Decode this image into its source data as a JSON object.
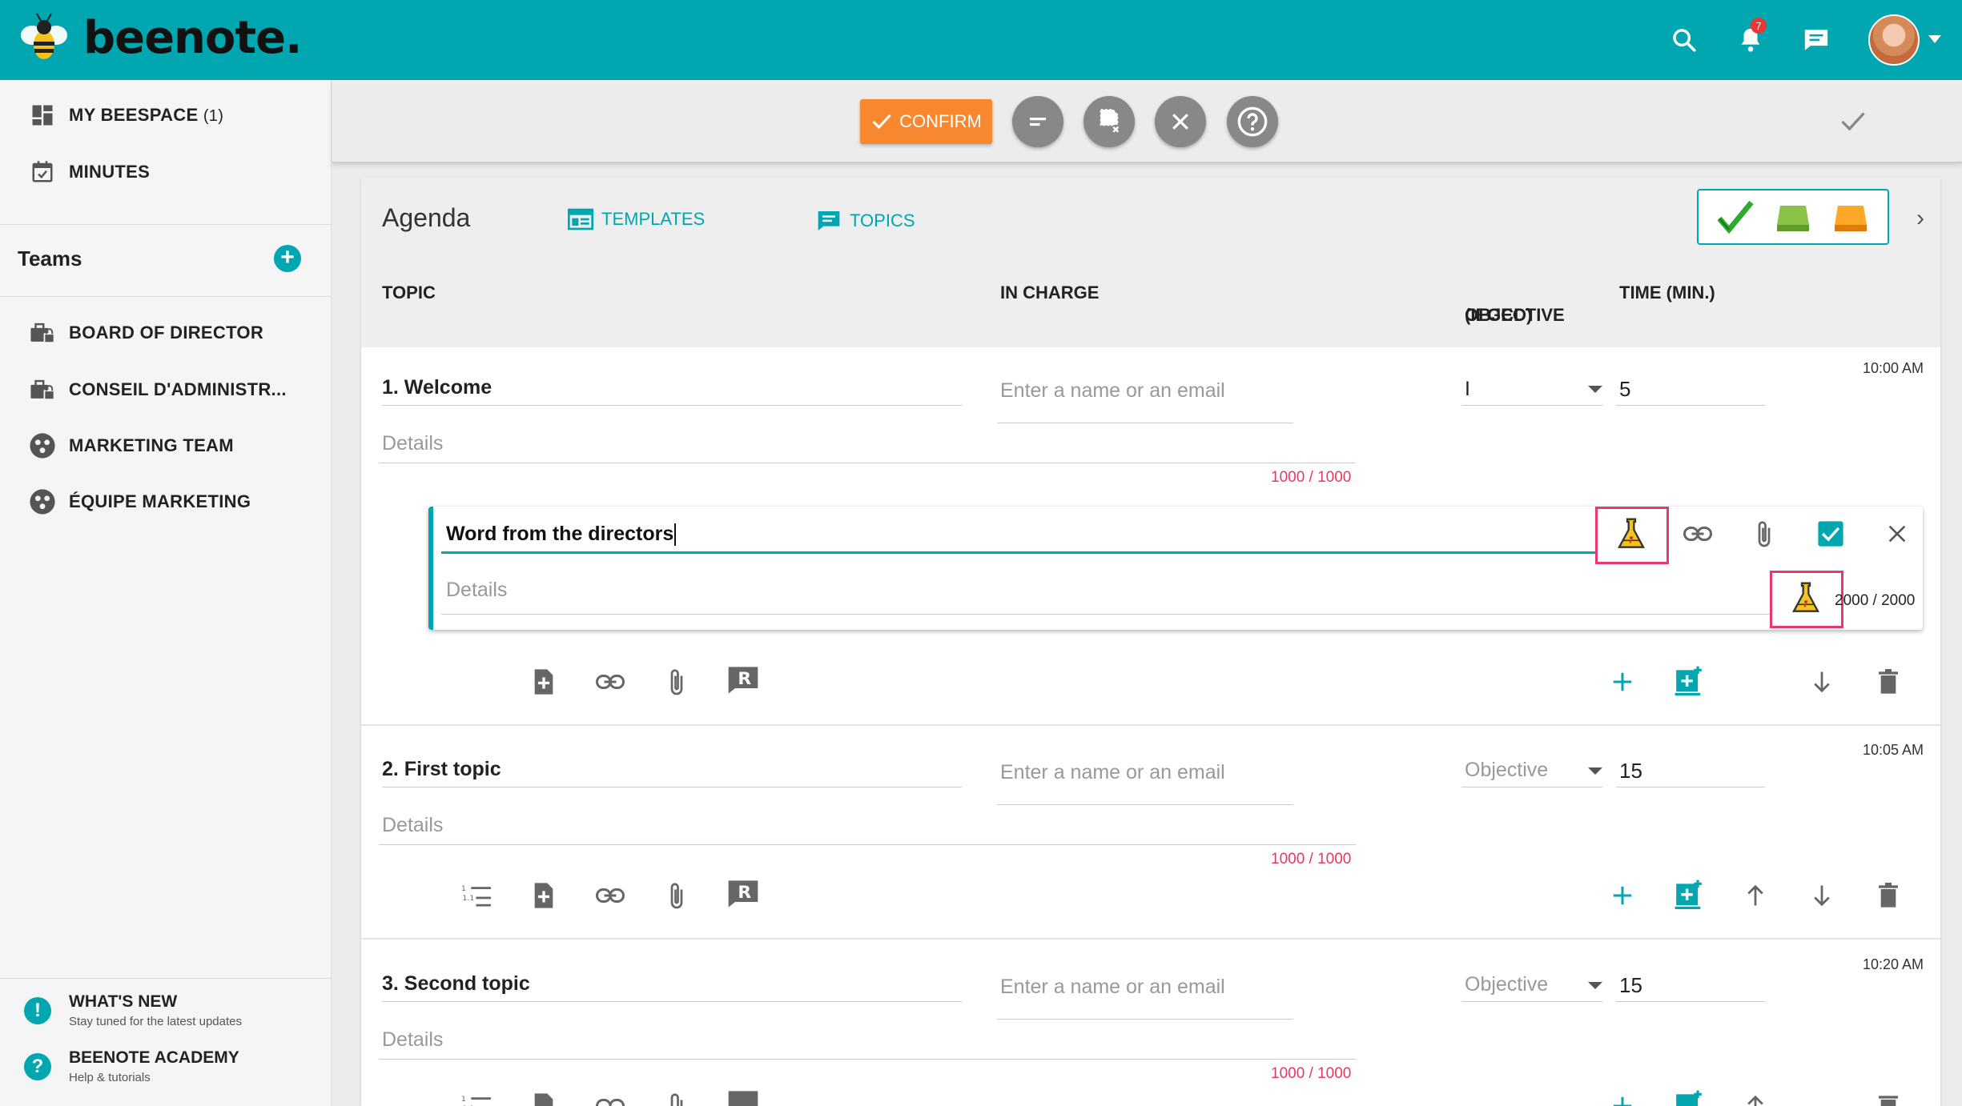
{
  "app": {
    "logo_text": "beenote."
  },
  "header": {
    "notification_count": "7"
  },
  "sidebar": {
    "nav": [
      {
        "label": "MY BEESPACE",
        "count": "(1)"
      },
      {
        "label": "MINUTES"
      }
    ],
    "teams_title": "Teams",
    "teams_add": "+",
    "teams": [
      {
        "label": "BOARD OF DIRECTOR"
      },
      {
        "label": "CONSEIL D'ADMINISTR..."
      },
      {
        "label": "MARKETING TEAM"
      },
      {
        "label": "ÉQUIPE MARKETING"
      }
    ],
    "footer": [
      {
        "title": "WHAT'S NEW",
        "subtitle": "Stay tuned for the latest updates",
        "icon": "!"
      },
      {
        "title": "BEENOTE ACADEMY",
        "subtitle": "Help & tutorials",
        "icon": "?"
      }
    ]
  },
  "toolbar": {
    "confirm_label": "CONFIRM"
  },
  "agenda": {
    "title": "Agenda",
    "tab_templates": "TEMPLATES",
    "tab_topics": "TOPICS",
    "columns": {
      "topic": "TOPIC",
      "in_charge": "IN CHARGE",
      "objective_line1": "OBJECTIVE",
      "objective_line2": "(IEGCD)",
      "time": "TIME (MIN.)"
    },
    "placeholders": {
      "in_charge": "Enter a name or an email",
      "details": "Details"
    },
    "topics": [
      {
        "title": "1. Welcome",
        "objective": "I",
        "minutes": "5",
        "time": "10:00 AM",
        "counter": "1000 / 1000"
      },
      {
        "title": "2. First topic",
        "objective": "Objective",
        "minutes": "15",
        "time": "10:05 AM",
        "counter": "1000 / 1000"
      },
      {
        "title": "3. Second topic",
        "objective": "Objective",
        "minutes": "15",
        "time": "10:20 AM",
        "counter": "1000 / 1000"
      }
    ],
    "subtopic": {
      "title": "Word from the directors",
      "details_placeholder": "Details",
      "counter": "2000 / 2000"
    }
  },
  "colors": {
    "brand": "#00a6b0",
    "confirm": "#f7882f",
    "highlight": "#e5396f",
    "counter": "#e53960"
  }
}
